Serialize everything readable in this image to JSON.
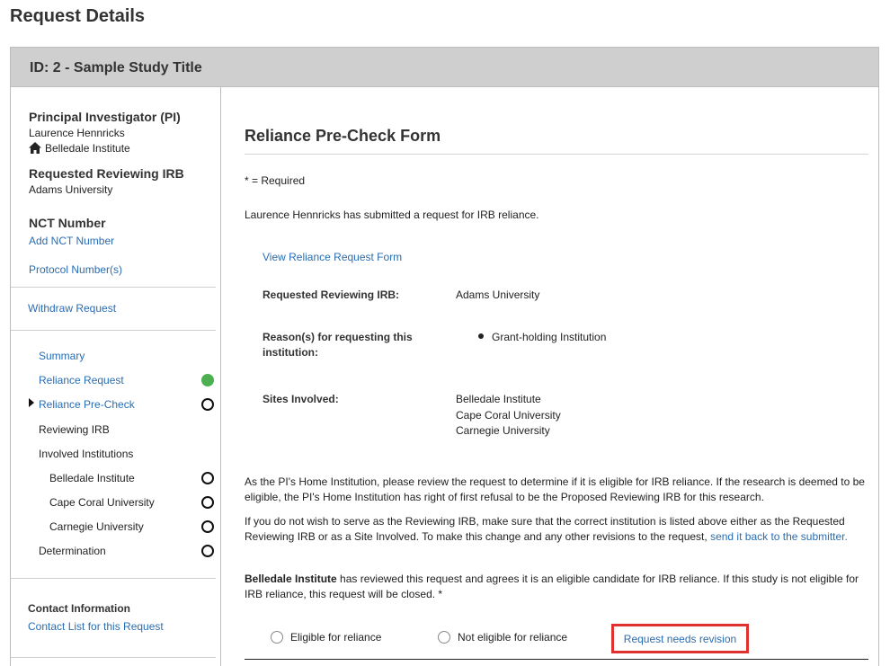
{
  "page": {
    "title": "Request Details"
  },
  "panel": {
    "header": "ID: 2 - Sample Study Title"
  },
  "sidebar": {
    "pi_heading": "Principal Investigator (PI)",
    "pi_name": "Laurence Hennricks",
    "pi_institution": "Belledale Institute",
    "irb_heading": "Requested Reviewing IRB",
    "irb_value": "Adams University",
    "nct_heading": "NCT Number",
    "nct_link": "Add NCT Number",
    "protocol_link": "Protocol Number(s)",
    "withdraw_link": "Withdraw Request",
    "nav": {
      "summary": "Summary",
      "reliance_request": "Reliance Request",
      "reliance_precheck": "Reliance Pre-Check",
      "reviewing_irb": "Reviewing IRB",
      "involved_institutions": "Involved Institutions",
      "inst_1": "Belledale Institute",
      "inst_2": "Cape Coral University",
      "inst_3": "Carnegie University",
      "determination": "Determination"
    },
    "contact_heading": "Contact Information",
    "contact_link": "Contact List for this Request",
    "status_colors": {
      "complete": "#4caf50"
    }
  },
  "form": {
    "title": "Reliance Pre-Check Form",
    "required_note": "* = Required",
    "intro": "Laurence Hennricks has submitted a request for IRB reliance.",
    "view_link": "View Reliance Request Form",
    "requested_irb_label": "Requested Reviewing IRB:",
    "requested_irb_value": "Adams University",
    "reason_label": "Reason(s) for requesting this institution:",
    "reason_value": "Grant-holding Institution",
    "sites_label": "Sites Involved:",
    "sites": [
      "Belledale Institute",
      "Cape Coral University",
      "Carnegie University"
    ],
    "para1": "As the PI's Home Institution, please review the request to determine if it is eligible for IRB reliance. If the research is deemed to be eligible, the PI's Home Institution has right of first refusal to be the Proposed Reviewing IRB for this research.",
    "para2_text": "If you do not wish to serve as the Reviewing IRB, make sure that the correct institution is listed above either as the Requested Reviewing IRB or as a Site Involved. To make this change and any other revisions to the request,",
    "para2_link": "send it back to the submitter.",
    "question_inst": "Belledale Institute",
    "question_text": "has reviewed this request and agrees it is an eligible candidate for IRB reliance. If this study is not eligible for IRB reliance, this request will be closed. *",
    "option_eligible": "Eligible for reliance",
    "option_not_eligible": "Not eligible for reliance",
    "revise_button": "Request needs revision"
  }
}
